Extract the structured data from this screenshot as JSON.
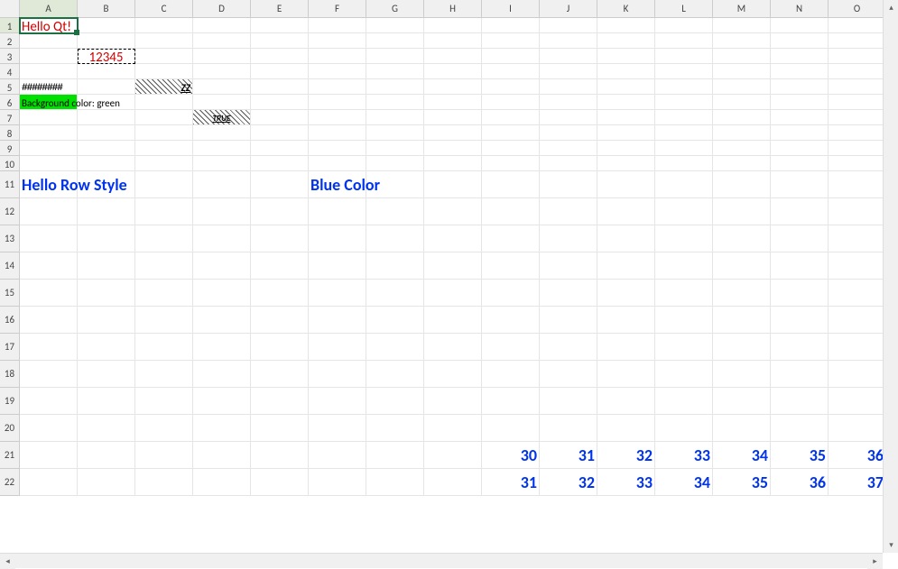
{
  "columns": [
    "A",
    "B",
    "C",
    "D",
    "E",
    "F",
    "G",
    "H",
    "I",
    "J",
    "K",
    "L",
    "M",
    "N",
    "O"
  ],
  "row_heights": {
    "11": 30,
    "12": 30,
    "13": 30,
    "14": 30,
    "15": 30,
    "16": 30,
    "17": 30,
    "18": 30,
    "19": 30,
    "20": 30,
    "21": 30,
    "22": 30
  },
  "active_cell": {
    "row": 1,
    "col": "A"
  },
  "cells": {
    "A1": {
      "text": "Hello Qt!",
      "cls": "red-text"
    },
    "B3": {
      "text": "12345",
      "cls": "red-text marquee",
      "align": "center"
    },
    "A5": {
      "text": "########",
      "cls": "hash"
    },
    "C5": {
      "text": "ZZ",
      "cls": "hatch zz"
    },
    "A6": {
      "text": "Background color: green",
      "cls": "green-bg ovf"
    },
    "D7": {
      "text": "TRUE",
      "cls": "hatch truebox"
    },
    "A11": {
      "text": "Hello Row Style",
      "cls": "blue-row ovf"
    },
    "F11": {
      "text": "Blue Color",
      "cls": "blue-row ovf"
    },
    "I21": {
      "text": "30",
      "cls": "blue-num"
    },
    "J21": {
      "text": "31",
      "cls": "blue-num"
    },
    "K21": {
      "text": "32",
      "cls": "blue-num"
    },
    "L21": {
      "text": "33",
      "cls": "blue-num"
    },
    "M21": {
      "text": "34",
      "cls": "blue-num"
    },
    "N21": {
      "text": "35",
      "cls": "blue-num"
    },
    "O21": {
      "text": "36",
      "cls": "blue-num"
    },
    "I22": {
      "text": "31",
      "cls": "blue-num"
    },
    "J22": {
      "text": "32",
      "cls": "blue-num"
    },
    "K22": {
      "text": "33",
      "cls": "blue-num"
    },
    "L22": {
      "text": "34",
      "cls": "blue-num"
    },
    "M22": {
      "text": "35",
      "cls": "blue-num"
    },
    "N22": {
      "text": "36",
      "cls": "blue-num"
    },
    "O22": {
      "text": "37",
      "cls": "blue-num"
    }
  },
  "visible_rows": 22,
  "chart_data": {
    "type": "table",
    "note": "Spreadsheet grid values as rendered",
    "rows": [
      {
        "row": 1,
        "A": "Hello Qt!"
      },
      {
        "row": 3,
        "B": "12345"
      },
      {
        "row": 5,
        "A": "########",
        "C": "ZZ"
      },
      {
        "row": 6,
        "A": "Background color: green"
      },
      {
        "row": 7,
        "D": "TRUE"
      },
      {
        "row": 11,
        "A": "Hello Row Style",
        "F": "Blue Color"
      },
      {
        "row": 21,
        "I": 30,
        "J": 31,
        "K": 32,
        "L": 33,
        "M": 34,
        "N": 35,
        "O": 36
      },
      {
        "row": 22,
        "I": 31,
        "J": 32,
        "K": 33,
        "L": 34,
        "M": 35,
        "N": 36,
        "O": 37
      }
    ]
  }
}
